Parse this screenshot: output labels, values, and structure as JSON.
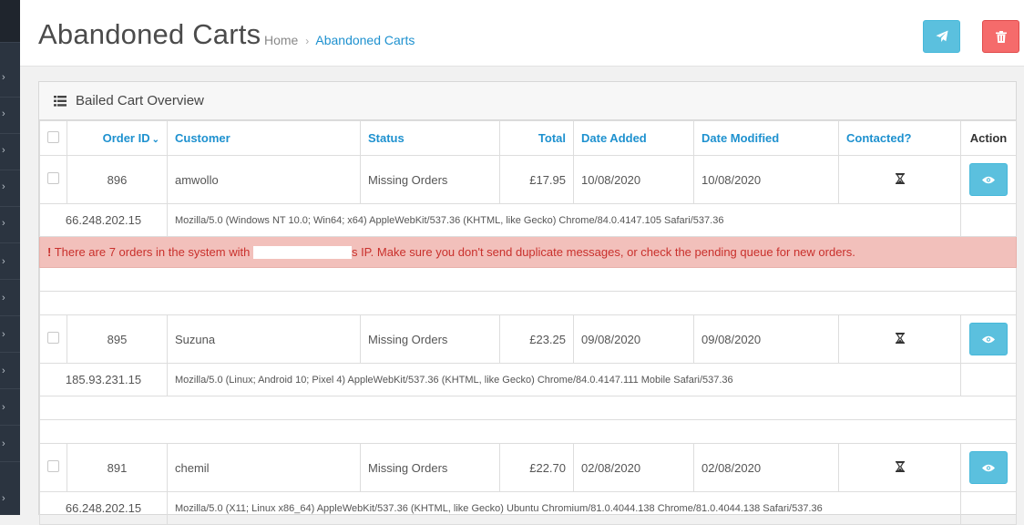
{
  "header": {
    "title": "Abandoned Carts",
    "breadcrumb": [
      {
        "label": "Home"
      },
      {
        "label": "Abandoned Carts"
      }
    ],
    "send_icon": "paper-plane-icon",
    "delete_icon": "trash-icon"
  },
  "panel": {
    "title": "Bailed Cart Overview",
    "icon": "list-icon"
  },
  "table": {
    "columns": {
      "order_id": "Order ID",
      "customer": "Customer",
      "status": "Status",
      "total": "Total",
      "date_added": "Date Added",
      "date_modified": "Date Modified",
      "contacted": "Contacted?",
      "action": "Action"
    },
    "rows": [
      {
        "order_id": "896",
        "customer": "amwollo",
        "status": "Missing Orders",
        "total": "£17.95",
        "date_added": "10/08/2020",
        "date_modified": "10/08/2020",
        "ip": "66.248.202.15",
        "user_agent": "Mozilla/5.0 (Windows NT 10.0; Win64; x64) AppleWebKit/537.36 (KHTML, like Gecko) Chrome/84.0.4147.105 Safari/537.36",
        "alert_pre": "There are 7 orders in the system with",
        "alert_post": "s IP. Make sure you don't send duplicate messages, or check the pending queue for new orders."
      },
      {
        "order_id": "895",
        "customer": "Suzuna",
        "status": "Missing Orders",
        "total": "£23.25",
        "date_added": "09/08/2020",
        "date_modified": "09/08/2020",
        "ip": "185.93.231.15",
        "user_agent": "Mozilla/5.0 (Linux; Android 10; Pixel 4) AppleWebKit/537.36 (KHTML, like Gecko) Chrome/84.0.4147.111 Mobile Safari/537.36"
      },
      {
        "order_id": "891",
        "customer": "chemil",
        "status": "Missing Orders",
        "total": "£22.70",
        "date_added": "02/08/2020",
        "date_modified": "02/08/2020",
        "ip": "66.248.202.15",
        "user_agent": "Mozilla/5.0 (X11; Linux x86_64) AppleWebKit/537.36 (KHTML, like Gecko) Ubuntu Chromium/81.0.4044.138 Chrome/81.0.4044.138 Safari/537.36"
      }
    ]
  },
  "colors": {
    "link": "#1e91cf",
    "info_button": "#5bc0de",
    "danger_button": "#f56b6b",
    "alert_bg": "#f2c0bb",
    "alert_text": "#c9302c",
    "sidebar": "#2b3440"
  }
}
